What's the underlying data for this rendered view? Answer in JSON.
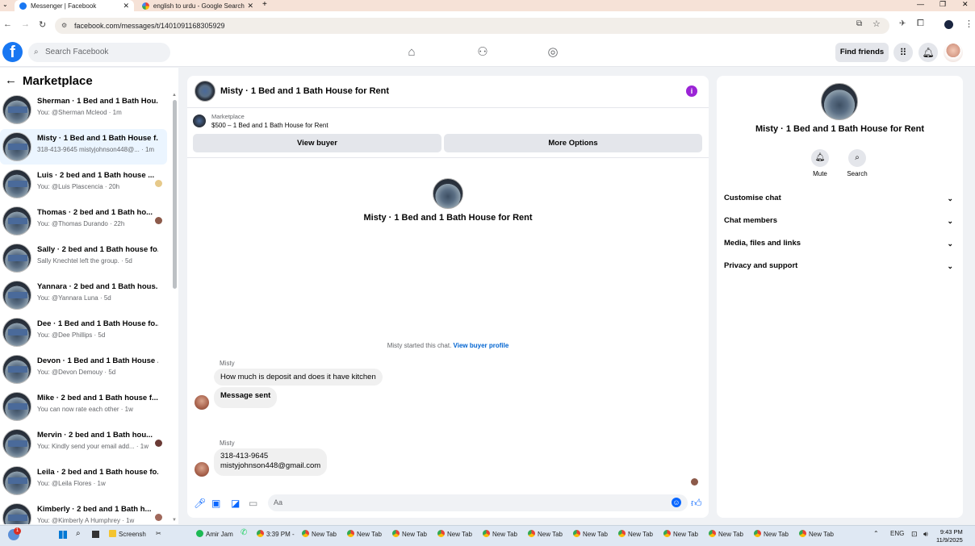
{
  "browser": {
    "tabs": [
      {
        "title": "Messenger | Facebook"
      },
      {
        "title": "english to urdu - Google Search"
      }
    ],
    "url": "facebook.com/messages/t/1401091168305929"
  },
  "fb_header": {
    "search_placeholder": "Search Facebook",
    "find_friends": "Find friends"
  },
  "left_panel": {
    "title": "Marketplace",
    "conversations": [
      {
        "title": "Sherman · 1 Bed and 1 Bath Hou...",
        "sub": "You: @Sherman Mcleod · 1m"
      },
      {
        "title": "Misty · 1 Bed and 1 Bath House f...",
        "sub": "318-413-9645 mistyjohnson448@... · 1m"
      },
      {
        "title": "Luis · 2 bed and 1 Bath house ...",
        "sub": "You: @Luis Plascencia · 20h"
      },
      {
        "title": "Thomas · 2 bed and 1 Bath ho...",
        "sub": "You: @Thomas Durando · 22h"
      },
      {
        "title": "Sally · 2 bed and 1 Bath house fo...",
        "sub": "Sally Knechtel left the group. · 5d"
      },
      {
        "title": "Yannara · 2 bed and 1 Bath hous...",
        "sub": "You: @Yannara Luna · 5d"
      },
      {
        "title": "Dee · 1 Bed and 1 Bath House fo...",
        "sub": "You: @Dee Phillips · 5d"
      },
      {
        "title": "Devon · 1 Bed and 1 Bath House ...",
        "sub": "You: @Devon Demouy · 5d"
      },
      {
        "title": "Mike · 2 bed and 1 Bath house f...",
        "sub": "You can now rate each other · 1w"
      },
      {
        "title": "Mervin · 2 bed and 1 Bath hou...",
        "sub": "You: Kindly send your email add... · 1w"
      },
      {
        "title": "Leila · 2 bed and 1 Bath house fo...",
        "sub": "You: @Leila Flores · 1w"
      },
      {
        "title": "Kimberly · 2 bed and 1 Bath h...",
        "sub": "You: @Kimberly A Humphrey · 1w"
      }
    ]
  },
  "chat": {
    "title": "Misty · 1 Bed and 1 Bath House for Rent",
    "marketplace_label": "Marketplace",
    "listing": "$500 – 1 Bed and 1 Bath House for Rent",
    "view_buyer": "View buyer",
    "more_options": "More Options",
    "center_title": "Misty · 1 Bed and 1 Bath House for Rent",
    "started_text": "Misty started this chat.",
    "view_buyer_profile": "View buyer profile",
    "messages": [
      {
        "sender": "Misty",
        "text": "How much is deposit and does it have kitchen"
      },
      {
        "text": "Message sent"
      },
      {
        "sender": "Misty",
        "line1": "318-413-9645",
        "line2": "mistyjohnson448@gmail.com"
      }
    ],
    "composer_placeholder": "Aa"
  },
  "right_panel": {
    "title": "Misty · 1 Bed and 1 Bath House for Rent",
    "mute": "Mute",
    "search": "Search",
    "sections": [
      "Customise chat",
      "Chat members",
      "Media, files and links",
      "Privacy and support"
    ]
  },
  "taskbar": {
    "items": [
      "Screenshot",
      "Amir Jama",
      "3:39 PM -",
      "New Tab",
      "New Tab",
      "New Tab",
      "New Tab",
      "New Tab",
      "New Tab",
      "New Tab",
      "New Tab",
      "New Tab",
      "New Tab",
      "New Tab",
      "New Tab"
    ],
    "lang": "ENG",
    "time": "9:43 PM",
    "date": "11/9/2025"
  }
}
